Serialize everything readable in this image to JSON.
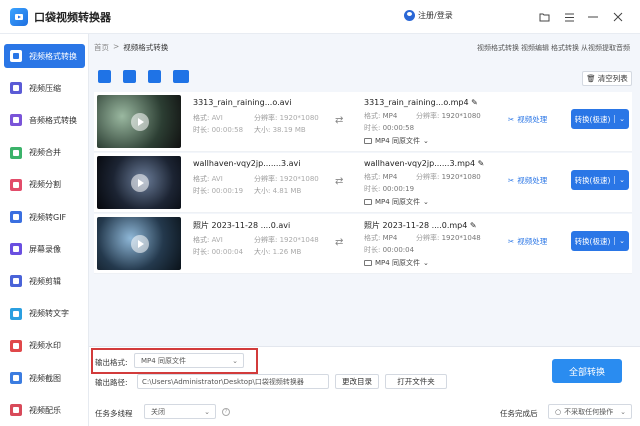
{
  "app": {
    "title": "口袋视频转换器",
    "login": "注册/登录"
  },
  "sidebar": {
    "items": [
      {
        "label": "视频格式转换",
        "icon": "convert-icon",
        "color": "#2a76e6"
      },
      {
        "label": "视频压缩",
        "icon": "compress-icon",
        "color": "#5b5bd6"
      },
      {
        "label": "音频格式转换",
        "icon": "audio-icon",
        "color": "#7a54d8"
      },
      {
        "label": "视频合并",
        "icon": "merge-icon",
        "color": "#3bb36a"
      },
      {
        "label": "视频分割",
        "icon": "split-icon",
        "color": "#e24c6a"
      },
      {
        "label": "视频转GIF",
        "icon": "gif-icon",
        "color": "#3a6fe0"
      },
      {
        "label": "屏幕录像",
        "icon": "record-icon",
        "color": "#6a4fe0"
      },
      {
        "label": "视频剪辑",
        "icon": "cut-icon",
        "color": "#4a63d8"
      },
      {
        "label": "视频转文字",
        "icon": "text-icon",
        "color": "#2a9fe0"
      },
      {
        "label": "视频水印",
        "icon": "watermark-icon",
        "color": "#e0484a"
      },
      {
        "label": "视频截图",
        "icon": "screenshot-icon",
        "color": "#3b7ce0"
      },
      {
        "label": "视频配乐",
        "icon": "music-icon",
        "color": "#d84a5a"
      }
    ]
  },
  "breadcrumb": {
    "home": "首页",
    "sep": ">",
    "current": "视频格式转换"
  },
  "top_links": [
    "视频格式转换",
    "视频编辑",
    "格式转换",
    "从视频提取音频"
  ],
  "toolbar": {
    "clear_label": "清空列表"
  },
  "files": [
    {
      "src_name": "3313_rain_raining...o.avi",
      "format_label": "格式:",
      "format": "AVI",
      "res_label": "分辨率:",
      "res": "1920*1080",
      "dur_label": "时长:",
      "duration": "00:00:58",
      "size_label": "大小:",
      "size": "38.19 MB",
      "out_name": "3313_rain_raining...o.mp4",
      "out_format": "MP4",
      "out_res": "1920*1080",
      "out_duration": "00:00:58",
      "out_preset": "MP4  同原文件"
    },
    {
      "src_name": "wallhaven-vqy2jp.......3.avi",
      "format_label": "格式:",
      "format": "AVI",
      "res_label": "分辨率:",
      "res": "1920*1080",
      "dur_label": "时长:",
      "duration": "00:00:19",
      "size_label": "大小:",
      "size": "4.81 MB",
      "out_name": "wallhaven-vqy2jp......3.mp4",
      "out_format": "MP4",
      "out_res": "1920*1080",
      "out_duration": "00:00:19",
      "out_preset": "MP4  同原文件"
    },
    {
      "src_name": "照片 2023-11-28 ....0.avi",
      "format_label": "格式:",
      "format": "AVI",
      "res_label": "分辨率:",
      "res": "1920*1048",
      "dur_label": "时长:",
      "duration": "00:00:04",
      "size_label": "大小:",
      "size": "1.26 MB",
      "out_name": "照片 2023-11-28 ....0.mp4",
      "out_format": "MP4",
      "out_res": "1920*1048",
      "out_duration": "00:00:04",
      "out_preset": "MP4  同原文件"
    }
  ],
  "row_actions": {
    "process_label": "视频处理",
    "convert_label": "转换(极速)"
  },
  "output_labels": {
    "format": "格式:",
    "res": "分辨率:",
    "duration": "时长:"
  },
  "bottom": {
    "output_format_label": "输出格式:",
    "output_format_value": "MP4  同原文件",
    "output_path_label": "输出路径:",
    "output_path_value": "C:\\Users\\Administrator\\Desktop\\口袋视频转换器",
    "change_dir": "更改目录",
    "open_folder": "打开文件夹",
    "convert_all": "全部转换",
    "multithread_label": "任务多线程",
    "multithread_value": "关闭",
    "after_done_label": "任务完成后",
    "after_done_value": "不采取任何操作"
  },
  "colors": {
    "accent": "#2a76e6",
    "highlight_frame": "#d23b3b",
    "convert_all": "#2a8cf0"
  }
}
